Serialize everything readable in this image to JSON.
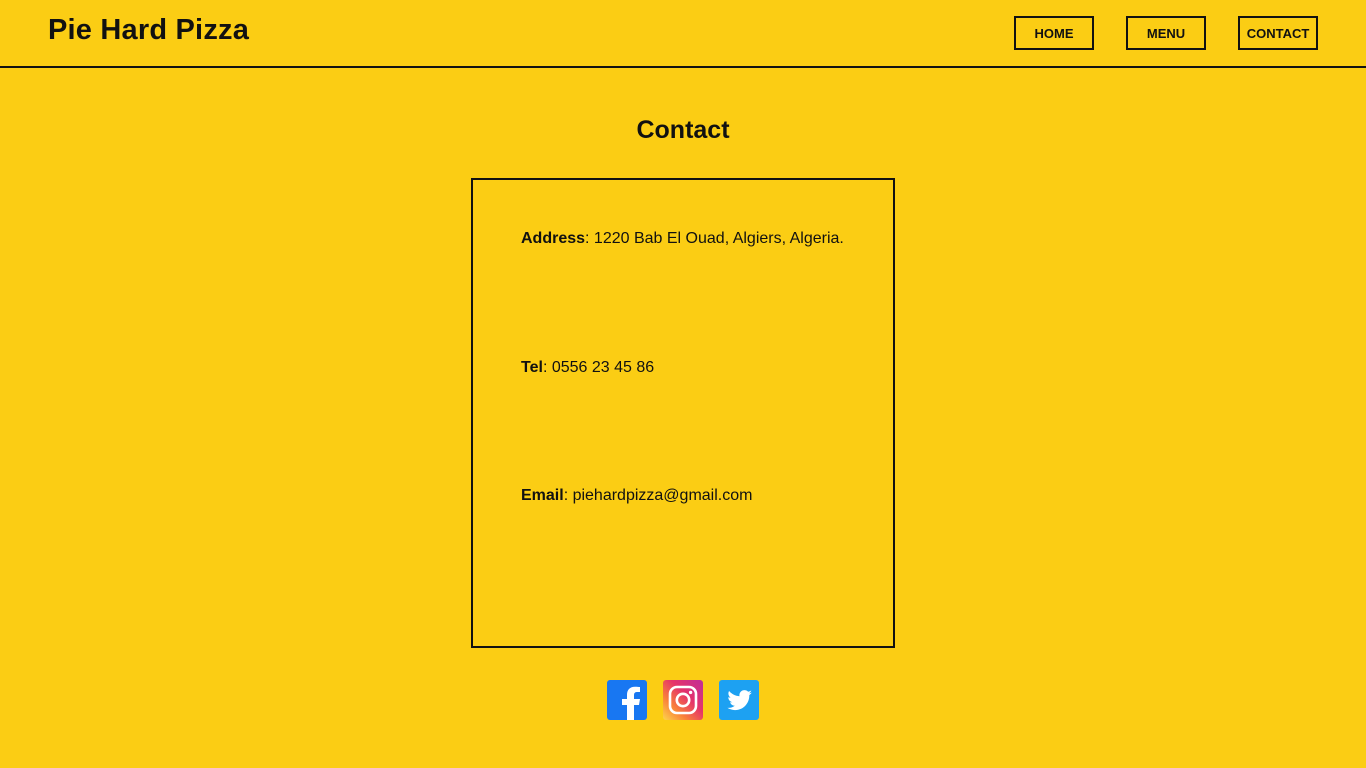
{
  "header": {
    "brand": "Pie Hard Pizza",
    "nav": [
      {
        "label": "HOME"
      },
      {
        "label": "MENU"
      },
      {
        "label": "CONTACT"
      }
    ]
  },
  "main": {
    "title": "Contact",
    "address": {
      "label": "Address",
      "value": ": 1220 Bab El Ouad, Algiers, Algeria."
    },
    "tel": {
      "label": "Tel",
      "value": ": 0556 23 45 86"
    },
    "email": {
      "label": "Email",
      "value": ": piehardpizza@gmail.com"
    }
  },
  "social": [
    {
      "icon": "facebook-icon",
      "color": "#1877F2"
    },
    {
      "icon": "instagram-icon",
      "color": "#E5336A"
    },
    {
      "icon": "twitter-icon",
      "color": "#1DA1F2"
    }
  ],
  "colors": {
    "background": "#FBCD14",
    "text": "#111111"
  }
}
